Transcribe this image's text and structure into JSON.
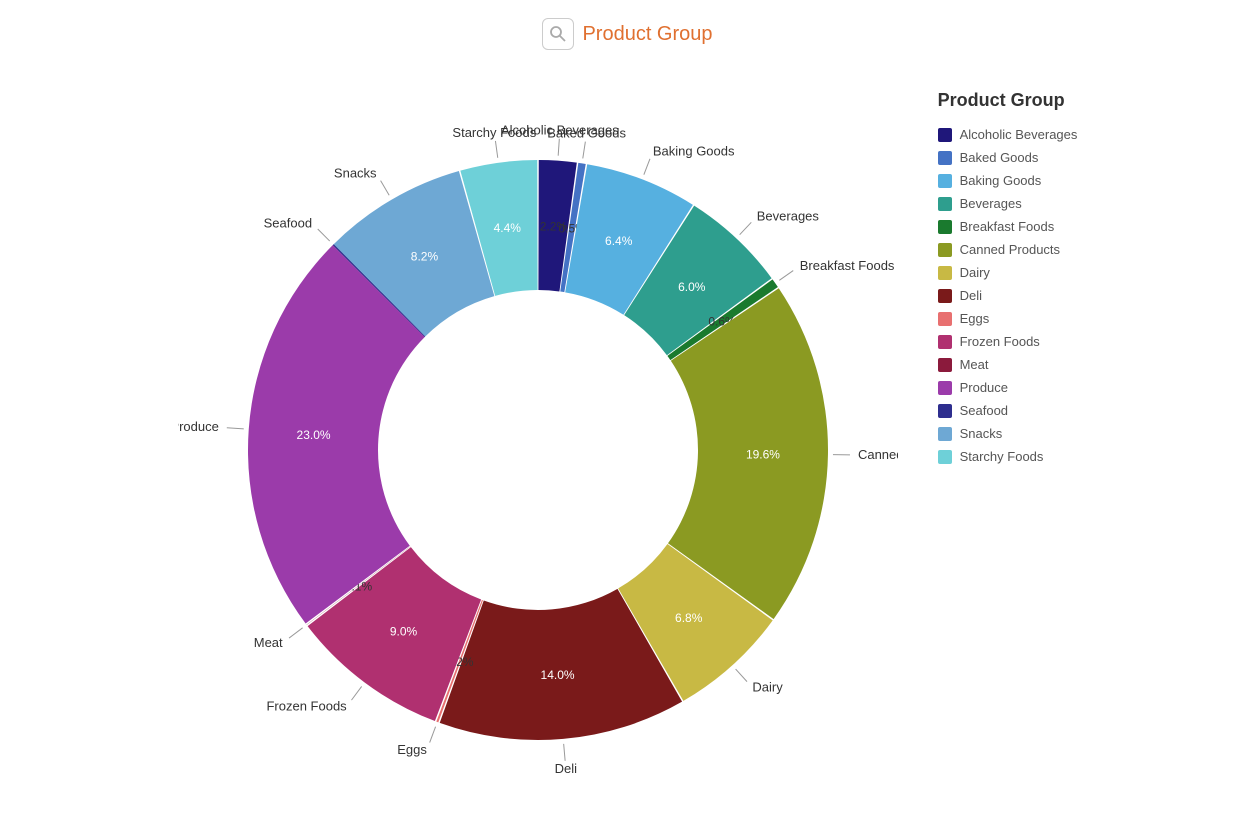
{
  "header": {
    "icon": "Q",
    "title": "Product Group"
  },
  "legend": {
    "title": "Product Group",
    "items": [
      {
        "label": "Alcoholic Beverages",
        "color": "#1f177a"
      },
      {
        "label": "Baked Goods",
        "color": "#4472c4"
      },
      {
        "label": "Baking Goods",
        "color": "#56b0e0"
      },
      {
        "label": "Beverages",
        "color": "#2e9e8e"
      },
      {
        "label": "Breakfast Foods",
        "color": "#1a7a2e"
      },
      {
        "label": "Canned Products",
        "color": "#8b9a22"
      },
      {
        "label": "Dairy",
        "color": "#c8b944"
      },
      {
        "label": "Deli",
        "color": "#7a1a1a"
      },
      {
        "label": "Eggs",
        "color": "#e87070"
      },
      {
        "label": "Frozen Foods",
        "color": "#b03070"
      },
      {
        "label": "Meat",
        "color": "#8b1a3c"
      },
      {
        "label": "Produce",
        "color": "#9b3baa"
      },
      {
        "label": "Seafood",
        "color": "#2e2e8e"
      },
      {
        "label": "Snacks",
        "color": "#6ea8d4"
      },
      {
        "label": "Starchy Foods",
        "color": "#6ed0d8"
      }
    ]
  },
  "chart": {
    "segments": [
      {
        "label": "Alcoholic Beverages",
        "pct": 2.2,
        "color": "#1f177a"
      },
      {
        "label": "Baked Goods",
        "pct": 0.5,
        "color": "#4472c4"
      },
      {
        "label": "Baking Goods",
        "pct": 6.4,
        "color": "#56b0e0"
      },
      {
        "label": "Beverages",
        "pct": 6.0,
        "color": "#2e9e8e"
      },
      {
        "label": "Breakfast Foods",
        "pct": 0.6,
        "color": "#1a7a2e"
      },
      {
        "label": "Canned Products",
        "pct": 19.6,
        "color": "#8b9a22"
      },
      {
        "label": "Dairy",
        "pct": 6.8,
        "color": "#c8b944"
      },
      {
        "label": "Deli",
        "pct": 14.0,
        "color": "#7a1a1a"
      },
      {
        "label": "Eggs",
        "pct": 0.2,
        "color": "#e87070"
      },
      {
        "label": "Frozen Foods",
        "pct": 9.0,
        "color": "#b03070"
      },
      {
        "label": "Meat",
        "pct": 0.1,
        "color": "#8b1a3c"
      },
      {
        "label": "Produce",
        "pct": 23.0,
        "color": "#9b3baa"
      },
      {
        "label": "Seafood",
        "pct": 0.0,
        "color": "#2e2e8e"
      },
      {
        "label": "Snacks",
        "pct": 8.2,
        "color": "#6ea8d4"
      },
      {
        "label": "Starchy Foods",
        "pct": 4.4,
        "color": "#6ed0d8"
      }
    ]
  },
  "labels": {
    "alcoholic_beverages": "Alcoholic Beverages",
    "baked_goods": "Baked Goods",
    "baking_goods": "Baking Goods",
    "beverages": "Beverages",
    "breakfast_foods": "Breakfast Foods",
    "canned_products": "Canned Products",
    "dairy": "Dairy",
    "deli": "Deli",
    "eggs": "Eggs",
    "frozen_foods": "Frozen Foods",
    "meat": "Meat",
    "produce": "Produce",
    "seafood": "Seafood",
    "snacks": "Snacks",
    "starchy_foods": "Starchy Foods"
  }
}
